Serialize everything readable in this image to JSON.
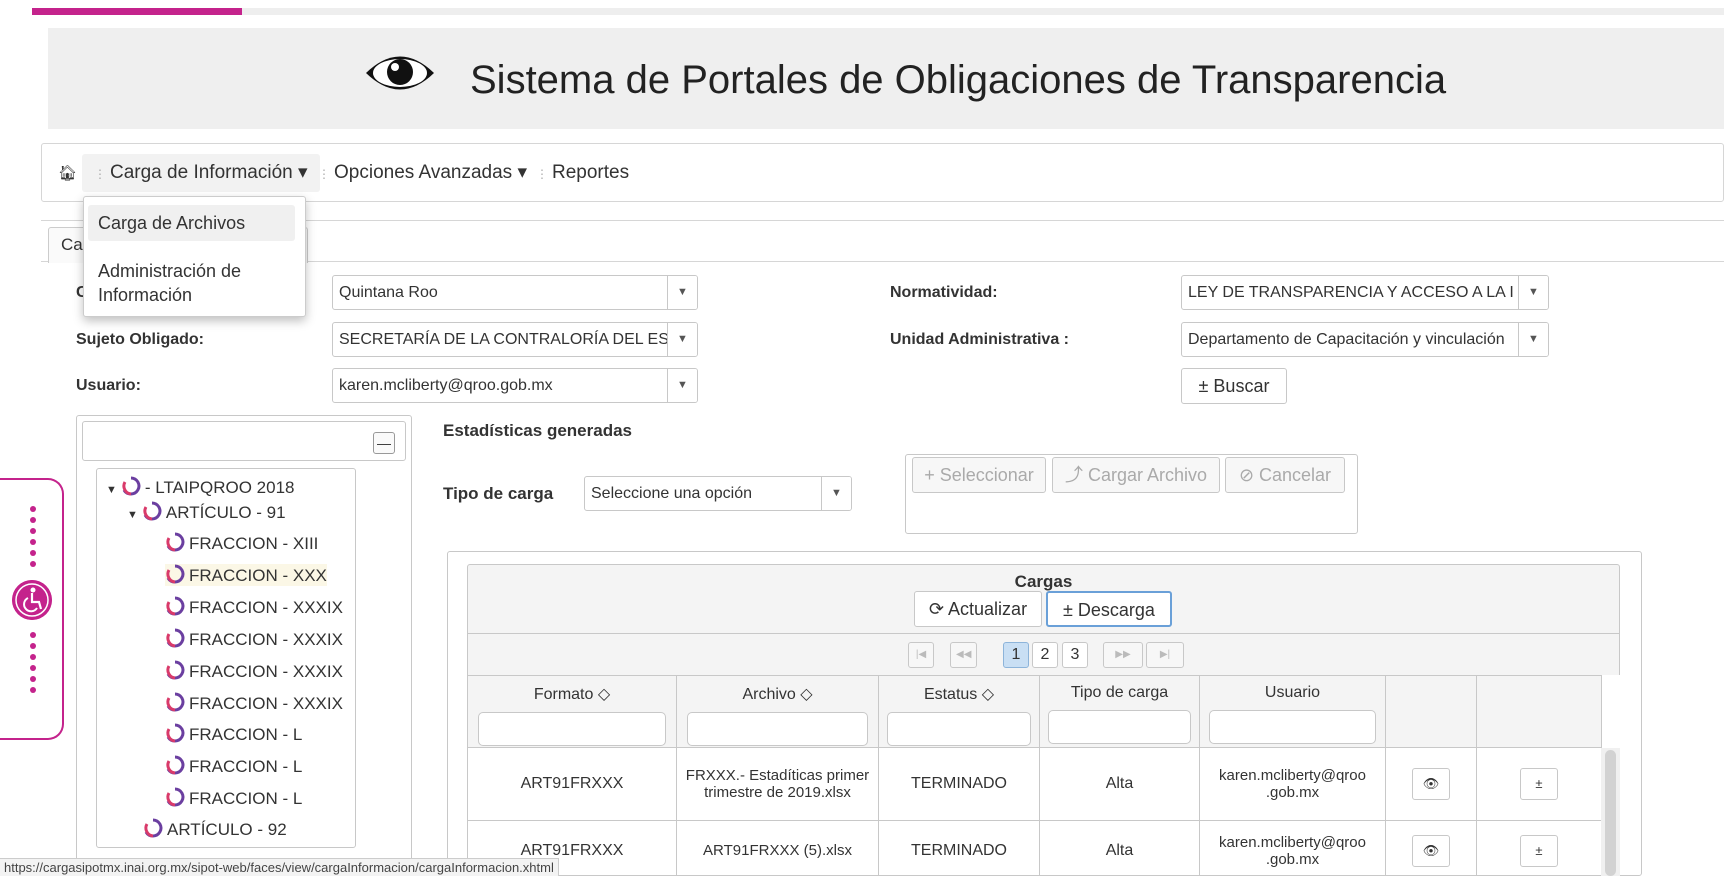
{
  "header": {
    "title": "Sistema de Portales de Obligaciones de Transparencia"
  },
  "menu": {
    "items": [
      "Carga de Información ▾",
      "Opciones Avanzadas ▾",
      "Reportes"
    ],
    "dropdown": [
      "Carga de Archivos",
      "Administración de",
      "Información"
    ]
  },
  "tab": {
    "label": "Ca"
  },
  "form": {
    "entidad_prefix": "C",
    "entidad_value": "Quintana Roo",
    "sujeto_label": "Sujeto Obligado:",
    "sujeto_value": "SECRETARÍA DE LA CONTRALORÍA DEL ES",
    "usuario_label": "Usuario:",
    "usuario_value": "karen.mcliberty@qroo.gob.mx",
    "normatividad_label": "Normatividad:",
    "normatividad_value": "LEY DE TRANSPARENCIA Y ACCESO A LA I",
    "unidad_label": "Unidad Administrativa :",
    "unidad_value": "Departamento de Capacitación y vinculación",
    "buscar_label": "± Buscar"
  },
  "tree": {
    "root": "- LTAIPQROO 2018",
    "articulo91": "ARTÍCULO - 91",
    "fracciones": [
      "FRACCION - XIII",
      "FRACCION - XXX",
      "FRACCION - XXXIX",
      "FRACCION - XXXIX",
      "FRACCION - XXXIX",
      "FRACCION - XXXIX",
      "FRACCION - L",
      "FRACCION - L",
      "FRACCION - L"
    ],
    "articulo92": "ARTÍCULO - 92"
  },
  "stats": {
    "title": "Estadísticas generadas",
    "tipo_label": "Tipo de carga",
    "tipo_value": "Seleccione una opción",
    "seleccionar": "+ Seleccionar",
    "cargar": "⤴ Cargar Archivo",
    "cancelar": "⊘ Cancelar"
  },
  "cargas": {
    "title": "Cargas",
    "actualizar": "⟳ Actualizar",
    "descarga": "± Descarga",
    "pages": [
      "1",
      "2",
      "3"
    ],
    "current_page": "1",
    "columns": [
      "Formato ◇",
      "Archivo ◇",
      "Estatus ◇",
      "Tipo de carga",
      "Usuario"
    ],
    "rows": [
      {
        "formato": "ART91FRXXX",
        "archivo": "FRXXX.- Estadíticas primer trimestre de 2019.xlsx",
        "estatus": "TERMINADO",
        "tipo": "Alta",
        "usuario": "karen.mcliberty@qroo .gob.mx"
      },
      {
        "formato": "ART91FRXXX",
        "archivo": "ART91FRXXX (5).xlsx",
        "estatus": "TERMINADO",
        "tipo": "Alta",
        "usuario": "karen.mcliberty@qroo .gob.mx"
      }
    ]
  },
  "status_url": "https://cargasipotmx.inai.org.mx/sipot-web/faces/view/cargaInformacion/cargaInformacion.xhtml",
  "colors": {
    "accent": "#c4238c",
    "focus": "#6aa0d8",
    "current_page": "#c9dff4"
  }
}
